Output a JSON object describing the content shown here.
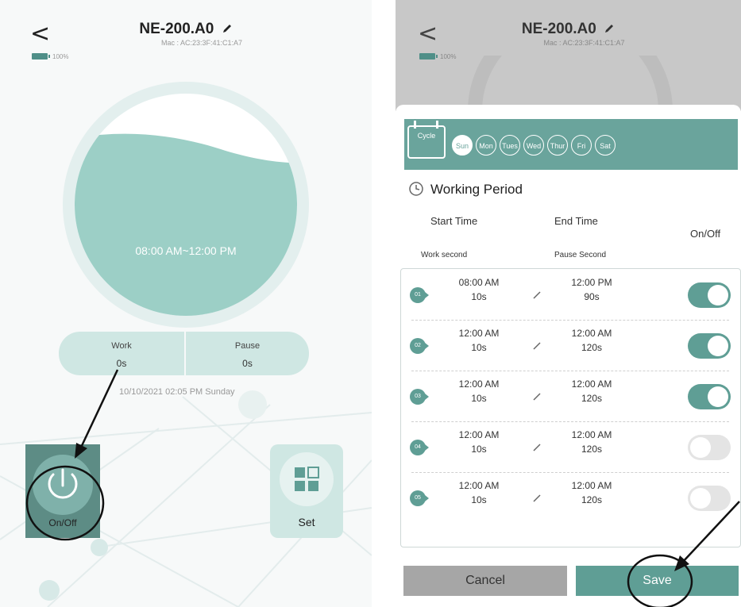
{
  "left": {
    "back": "<",
    "device_name": "NE-200.A0",
    "mac": "Mac : AC:23:3F:41:C1:A7",
    "battery_pct": "100%",
    "fill_level": 0.8,
    "period": "08:00 AM~12:00 PM",
    "work_label": "Work",
    "work_value": "0s",
    "pause_label": "Pause",
    "pause_value": "0s",
    "datetime": "10/10/2021 02:05 PM Sunday",
    "onoff_label": "On/Off",
    "set_label": "Set",
    "accent": "#9ccfc6"
  },
  "right": {
    "back": "<",
    "device_name": "NE-200.A0",
    "mac": "Mac : AC:23:3F:41:C1:A7",
    "battery_pct": "100%",
    "cycle_label": "Cycle",
    "days": [
      "Sun",
      "Mon",
      "Tues",
      "Wed",
      "Thur",
      "Fri",
      "Sat"
    ],
    "active_day": "Sun",
    "section_title": "Working Period",
    "col_start": "Start Time",
    "col_end": "End Time",
    "col_onoff": "On/Off",
    "sub_work": "Work second",
    "sub_pause": "Pause Second",
    "rows": [
      {
        "num": "01",
        "start": "08:00 AM",
        "work": "10s",
        "end": "12:00 PM",
        "pause": "90s",
        "on": true
      },
      {
        "num": "02",
        "start": "12:00 AM",
        "work": "10s",
        "end": "12:00 AM",
        "pause": "120s",
        "on": true
      },
      {
        "num": "03",
        "start": "12:00 AM",
        "work": "10s",
        "end": "12:00 AM",
        "pause": "120s",
        "on": true
      },
      {
        "num": "04",
        "start": "12:00 AM",
        "work": "10s",
        "end": "12:00 AM",
        "pause": "120s",
        "on": false
      },
      {
        "num": "05",
        "start": "12:00 AM",
        "work": "10s",
        "end": "12:00 AM",
        "pause": "120s",
        "on": false
      }
    ],
    "cancel_label": "Cancel",
    "save_label": "Save",
    "accent": "#5f9e95"
  }
}
